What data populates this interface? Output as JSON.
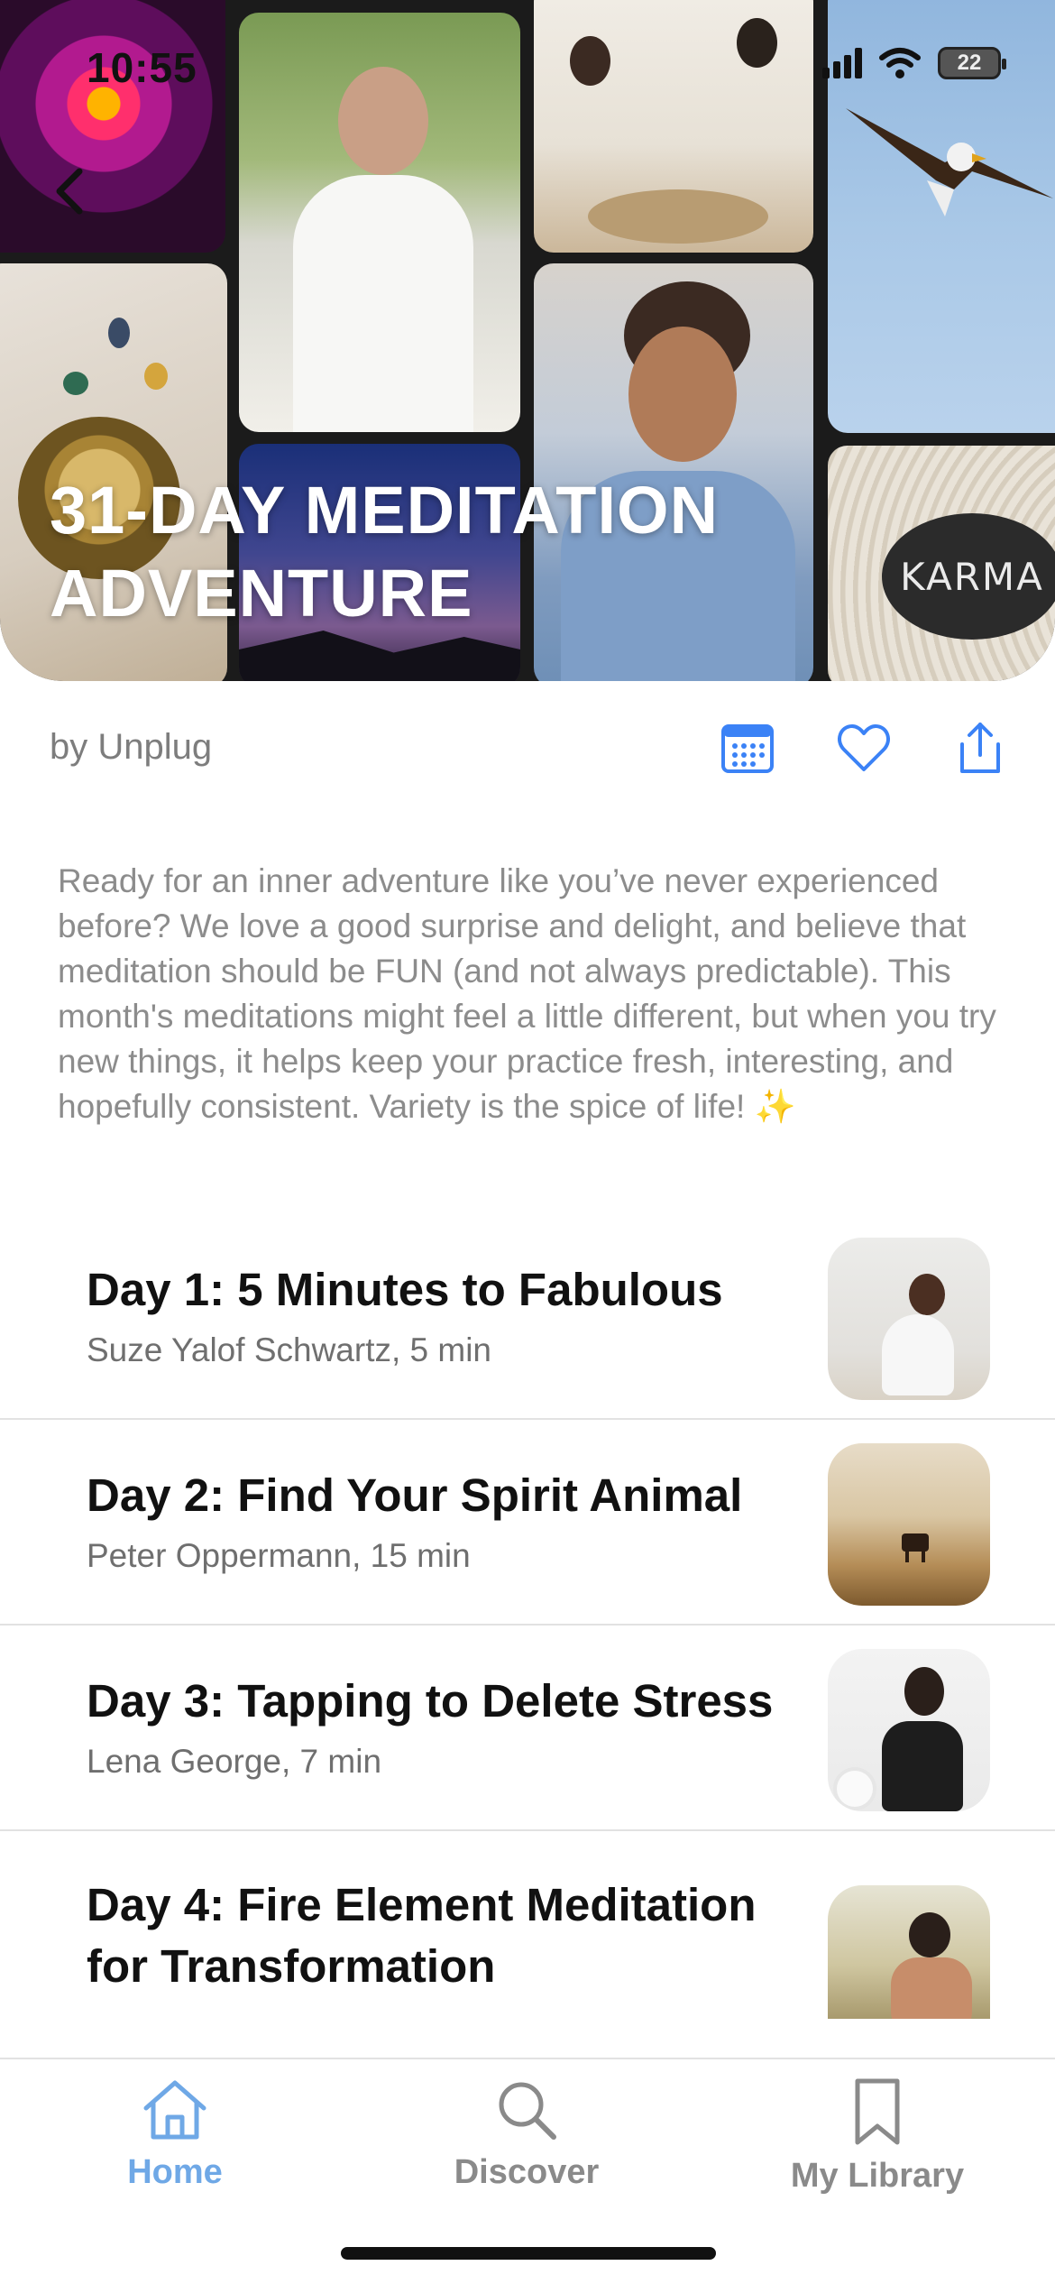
{
  "status_bar": {
    "time": "10:55",
    "battery": "22"
  },
  "hero": {
    "title_line1": "31-DAY MEDITATION",
    "title_line2": "ADVENTURE",
    "karma_stone_text": "KARMA",
    "back_icon": "chevron-left-icon"
  },
  "meta": {
    "author": "by Unplug",
    "actions": [
      "calendar-icon",
      "heart-icon",
      "share-icon"
    ],
    "accent_color": "#3b82f6"
  },
  "description": "Ready for an inner adventure like you’ve never experienced before? We love a good surprise and delight, and believe that meditation should be FUN (and not always predictable). This month's meditations might feel a little different, but when you try new things, it helps keep your practice fresh, interesting, and hopefully consistent. Variety is the spice of life! ✨",
  "episodes": [
    {
      "title": "Day 1: 5 Minutes to Fabulous",
      "subtitle": "Suze Yalof Schwartz, 5 min"
    },
    {
      "title": "Day 2: Find Your Spirit Animal",
      "subtitle": "Peter Oppermann, 15 min"
    },
    {
      "title": "Day 3: Tapping to Delete Stress",
      "subtitle": "Lena George, 7 min"
    },
    {
      "title_line1": "Day 4: Fire Element Meditation",
      "title_line2": "for Transformation"
    }
  ],
  "tabs": [
    {
      "label": "Home",
      "icon": "home-icon",
      "active": true,
      "color": "#6fa8e6"
    },
    {
      "label": "Discover",
      "icon": "search-icon",
      "active": false,
      "color": "#8a8a8a"
    },
    {
      "label": "My Library",
      "icon": "bookmark-icon",
      "active": false,
      "color": "#8a8a8a"
    }
  ]
}
